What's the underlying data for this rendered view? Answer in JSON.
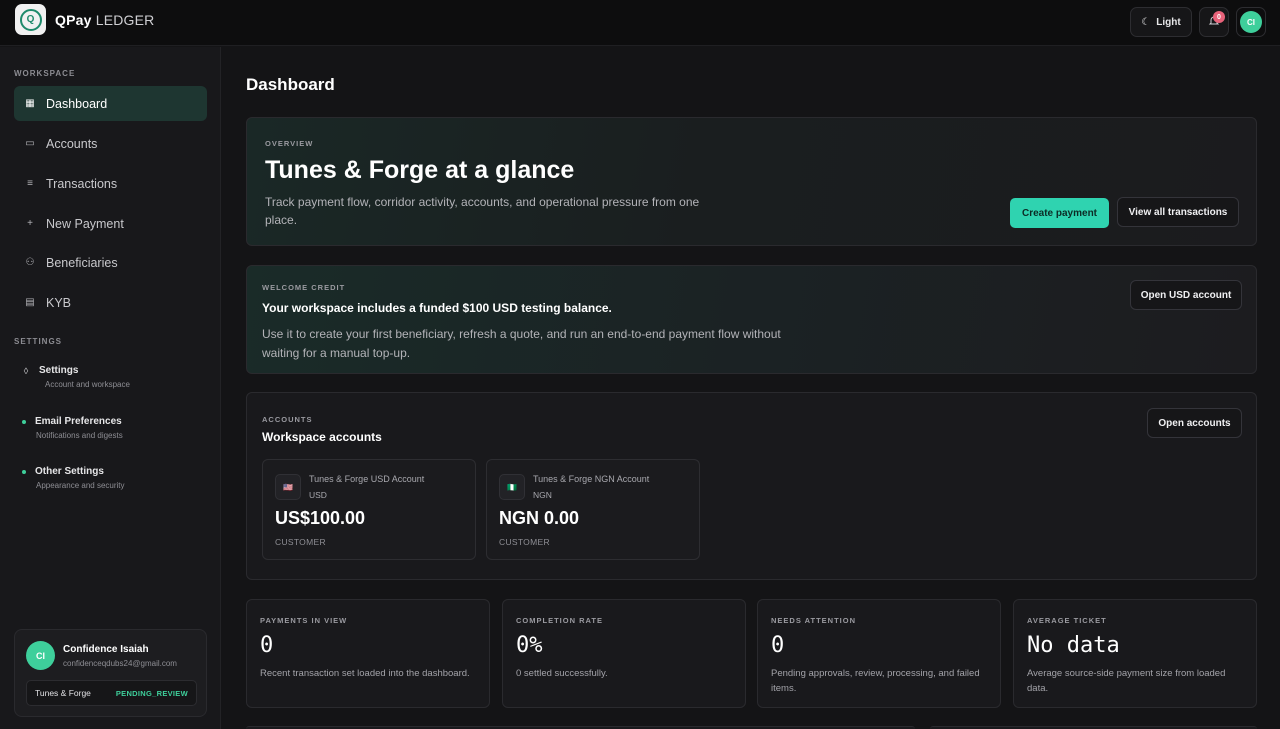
{
  "app": {
    "brand_main": "QPay",
    "brand_sub": "LEDGER",
    "logo_glyph": "Q"
  },
  "topbar": {
    "theme_label": "Light",
    "theme_icon": "☾",
    "notification_count": "0",
    "avatar_initials": "CI"
  },
  "sidebar": {
    "workspace_label": "WORKSPACE",
    "items": [
      {
        "label": "Dashboard",
        "icon": "▦",
        "active": true
      },
      {
        "label": "Accounts",
        "icon": "▭"
      },
      {
        "label": "Transactions",
        "icon": "≡"
      },
      {
        "label": "New Payment",
        "icon": "+"
      },
      {
        "label": "Beneficiaries",
        "icon": "⚇"
      },
      {
        "label": "KYB",
        "icon": "▤"
      }
    ],
    "settings_label": "SETTINGS",
    "settings_items": [
      {
        "title": "Settings",
        "subtitle": "Account and workspace",
        "icon": "◊"
      },
      {
        "title": "Email Preferences",
        "subtitle": "Notifications and digests"
      },
      {
        "title": "Other Settings",
        "subtitle": "Appearance and security"
      }
    ],
    "user": {
      "initials": "CI",
      "name": "Confidence Isaiah",
      "email": "confidenceqdubs24@gmail.com",
      "org": "Tunes & Forge",
      "status": "PENDING_REVIEW"
    }
  },
  "main": {
    "title": "Dashboard",
    "overview": {
      "eyebrow": "OVERVIEW",
      "title": "Tunes & Forge at a glance",
      "description": "Track payment flow, corridor activity, accounts, and operational pressure from one place.",
      "primary_button": "Create payment",
      "secondary_button": "View all transactions"
    },
    "welcome": {
      "eyebrow": "WELCOME CREDIT",
      "title": "Your workspace includes a funded $100 USD testing balance.",
      "description": "Use it to create your first beneficiary, refresh a quote, and run an end-to-end payment flow without waiting for a manual top-up.",
      "button": "Open USD account"
    },
    "accounts": {
      "eyebrow": "ACCOUNTS",
      "title": "Workspace accounts",
      "button": "Open accounts",
      "tiles": [
        {
          "name": "Tunes & Forge USD Account",
          "currency": "USD",
          "balance": "US$100.00",
          "type": "CUSTOMER",
          "flag": "🇺🇸"
        },
        {
          "name": "Tunes & Forge NGN Account",
          "currency": "NGN",
          "balance": "NGN 0.00",
          "type": "CUSTOMER",
          "flag": "🇳🇬"
        }
      ]
    },
    "stats": [
      {
        "label": "PAYMENTS IN VIEW",
        "value": "0",
        "description": "Recent transaction set loaded into the dashboard."
      },
      {
        "label": "COMPLETION RATE",
        "value": "0%",
        "description": "0 settled successfully."
      },
      {
        "label": "NEEDS ATTENTION",
        "value": "0",
        "description": "Pending approvals, review, processing, and failed items."
      },
      {
        "label": "AVERAGE TICKET",
        "value": "No data",
        "description": "Average source-side payment size from loaded data."
      }
    ]
  },
  "colors": {
    "accent": "#2fd3b0",
    "avatar": "#3ecf9b",
    "badge": "#e8627a",
    "background": "#141416"
  }
}
